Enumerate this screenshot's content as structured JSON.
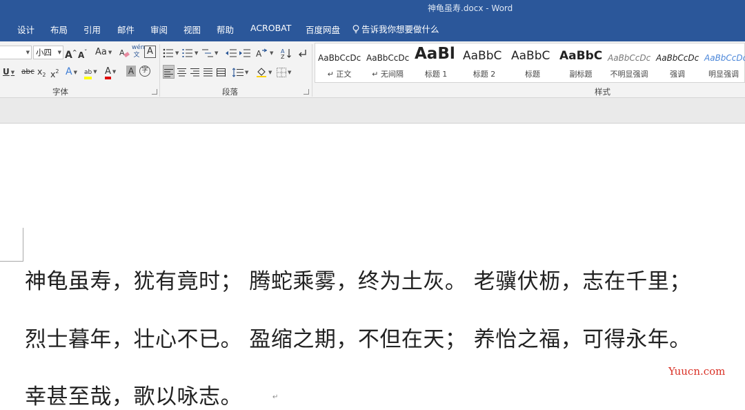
{
  "window": {
    "title": "神龟虽寿.docx  -  Word"
  },
  "tabs": [
    "设计",
    "布局",
    "引用",
    "邮件",
    "审阅",
    "视图",
    "帮助",
    "ACROBAT",
    "百度网盘"
  ],
  "tell_me": "告诉我你想要做什么",
  "font_group": {
    "label": "字体",
    "font_size": "小四",
    "grow_label": "A",
    "shrink_label": "A",
    "case_label": "Aa",
    "underline_label": "U",
    "strike_label": "abc",
    "subscript_label": "x",
    "superscript_label": "x",
    "sub_mark": "2",
    "sup_mark": "2",
    "phonetic_label": "wén文",
    "char_border_label": "A",
    "text_effects_label": "A",
    "highlight_label": "ab",
    "font_color_label": "A",
    "char_shading_label": "A",
    "enclose_label": "字",
    "highlight_color": "#ffff00",
    "font_color": "#e00000"
  },
  "paragraph_group": {
    "label": "段落"
  },
  "styles_group": {
    "label": "样式",
    "items": [
      {
        "sample": "AaBbCcDc",
        "name": "↵ 正文"
      },
      {
        "sample": "AaBbCcDc",
        "name": "↵ 无间隔"
      },
      {
        "sample": "AaBl",
        "name": "标题 1"
      },
      {
        "sample": "AaBbC",
        "name": "标题 2"
      },
      {
        "sample": "AaBbC",
        "name": "标题"
      },
      {
        "sample": "AaBbC",
        "name": "副标题"
      },
      {
        "sample": "AaBbCcDc",
        "name": "不明显强调"
      },
      {
        "sample": "AaBbCcDc",
        "name": "强调"
      },
      {
        "sample": "AaBbCcDc",
        "name": "明显强调"
      }
    ]
  },
  "document": {
    "lines": [
      "神龟虽寿，犹有竟时；  腾蛇乘雾，终为土灰。  老骥伏枥，志在千里；",
      "烈士暮年，壮心不已。  盈缩之期，不但在天；  养怡之福，可得永年。",
      "幸甚至哉，歌以咏志。"
    ],
    "paragraph_mark": "↵"
  },
  "watermark": "Yuucn.com"
}
